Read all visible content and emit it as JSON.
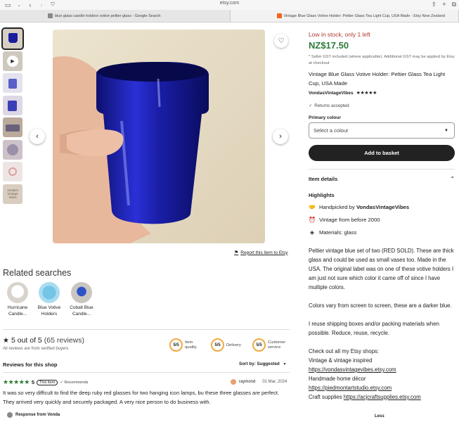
{
  "browser": {
    "url": "etsy.com",
    "tabs": [
      {
        "title": "blue glass candle holders votive peltier glass - Google Search"
      },
      {
        "title": "Vintage Blue Glass Votive Holder: Peltier Glass Tea Light Cup, USA Made - Etsy New Zealand"
      }
    ]
  },
  "gallery": {
    "report_link": "Report this item to Etsy",
    "thumb_labels": [
      "Vonda's Vintage Vibes"
    ]
  },
  "related": {
    "heading": "Related searches",
    "items": [
      {
        "label": "Hurricane Candle..."
      },
      {
        "label": "Blue Votive Holders"
      },
      {
        "label": "Cobalt Blue Candle..."
      }
    ]
  },
  "reviews": {
    "summary": "5 out of 5",
    "count": "(65 reviews)",
    "verified": "All reviews are from verified buyers",
    "metrics": [
      {
        "score": "5/5",
        "label": "Item quality"
      },
      {
        "score": "5/5",
        "label": "Delivery"
      },
      {
        "score": "5/5",
        "label": "Customer service"
      }
    ],
    "section_title": "Reviews for this shop",
    "sort_label": "Sort by: Suggested",
    "first": {
      "rating": "5",
      "badge": "This item",
      "recommends": "Recommends",
      "reviewer": "raymond",
      "date": "01 Mar, 2024",
      "text": "It was so very difficult to find the deep ruby red glasses for two hanging icon lamps, bu these three glasses are perfect. They arrived very quickly and securely packaged. A very nice person to do business with.",
      "response_label": "Response from Vonda"
    }
  },
  "listing": {
    "stock": "Low in stock, only 1 left",
    "price": "NZ$17.50",
    "gst_note": "* Seller GST included (where applicable). Additional GST may be applied by Etsy at checkout",
    "title": "Vintage Blue Glass Votive Holder: Peltier Glass Tea Light Cup, USA Made",
    "shop": "VondasVintageVibes",
    "returns": "Returns accepted",
    "option_label": "Primary colour",
    "option_placeholder": "Select a colour",
    "add_to_basket": "Add to basket",
    "details_label": "Item details",
    "highlights_label": "Highlights",
    "highlights": {
      "handpicked_prefix": "Handpicked by ",
      "handpicked_shop": "VondasVintageVibes",
      "vintage": "Vintage from before 2000",
      "materials": "Materials: glass"
    },
    "description": {
      "p1": "Peltier vintage blue set of two (RED SOLD). These are thick glass and could be used as small vases too. Made in the USA. The original label was on one of these votive holders I am just not sure which color it came off of since I have multiple colors.",
      "p2": "Colors vary from screen to screen, these are a darker blue.",
      "p3": "I reuse shipping boxes and/or packing materials when possible. Reduce, reuse, recycle.",
      "p4": "Check out all my Etsy shops:",
      "l1": "Vintage & vintage inspired",
      "u1": "https://vondasvintagevibes.etsy.com",
      "l2": "Handmade home décor",
      "u2": "https://piedmontartstudio.etsy.com",
      "l3": "Craft supplies ",
      "u3": "https://acjcraftsupplies.etsy.com"
    },
    "less_label": "Less"
  },
  "colors": {
    "price_green": "#2d7a3a",
    "stock_red": "#b03a2e",
    "cobalt": "#1a1e9e",
    "star_gold": "#f1a840"
  }
}
